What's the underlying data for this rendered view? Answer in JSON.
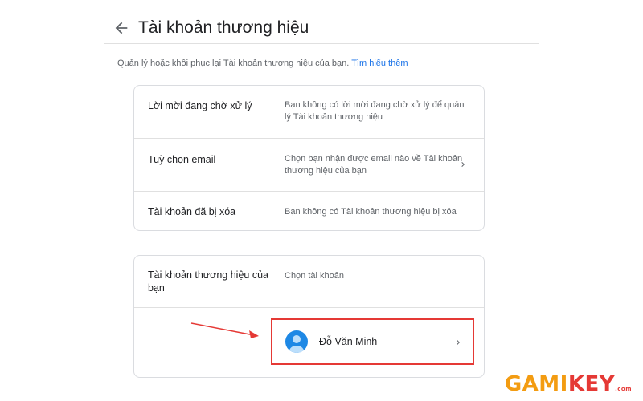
{
  "header": {
    "title": "Tài khoản thương hiệu"
  },
  "description": {
    "text": "Quản lý hoặc khôi phục lại Tài khoản thương hiệu của bạn.",
    "link": "Tìm hiểu thêm"
  },
  "card1": {
    "rows": [
      {
        "label": "Lời mời đang chờ xử lý",
        "value": "Bạn không có lời mời đang chờ xử lý để quản lý Tài khoản thương hiệu"
      },
      {
        "label": "Tuỳ chọn email",
        "value": "Chọn bạn nhận được email nào về Tài khoản thương hiệu của bạn",
        "icon": "chevron-right-icon"
      },
      {
        "label": "Tài khoản đã bị xóa",
        "value": "Bạn không có Tài khoản thương hiệu bị xóa"
      }
    ]
  },
  "card2": {
    "label": "Tài khoản thương hiệu của bạn",
    "value": "Chọn tài khoản",
    "account": {
      "name": "Đỗ Văn Minh",
      "icon": "avatar-icon"
    }
  },
  "watermark": {
    "part1": "GAMI",
    "part2": "KEY",
    "suffix": ".com"
  },
  "colors": {
    "link": "#1a73e8",
    "highlight": "#e53935",
    "avatar": "#1e88e5",
    "watermark_orange": "#f39c12"
  }
}
